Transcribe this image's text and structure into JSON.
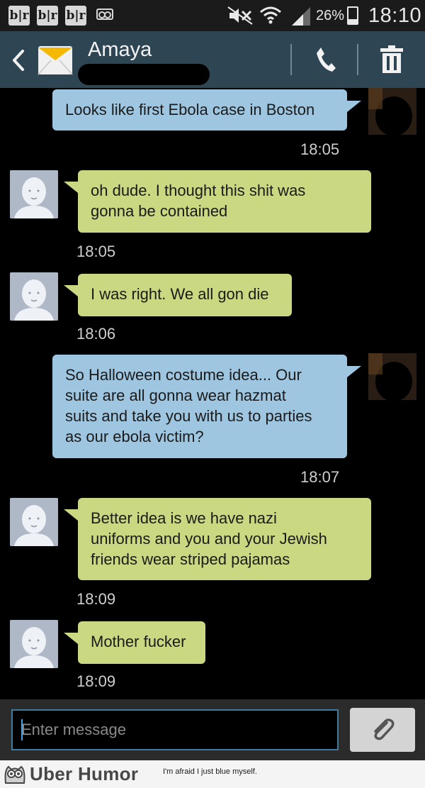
{
  "status_bar": {
    "notification_icons": [
      "b|r",
      "b|r",
      "b|r"
    ],
    "battery_percent": "26%",
    "battery_level": 0.26,
    "time": "18:10",
    "icons": [
      "voicemail-icon",
      "mute-icon",
      "wifi-icon",
      "signal-icon",
      "battery-icon"
    ]
  },
  "header": {
    "contact_name": "Amaya",
    "icons": [
      "back-icon",
      "envelope-icon",
      "phone-icon",
      "trash-icon"
    ]
  },
  "messages": [
    {
      "direction": "outgoing",
      "text_lines": [
        "Looks like first Ebola case in Boston"
      ],
      "time": "18:05"
    },
    {
      "direction": "incoming",
      "text_lines": [
        "oh dude. I thought this shit was",
        "gonna be contained"
      ],
      "time": "18:05"
    },
    {
      "direction": "incoming",
      "text_lines": [
        "I was right. We all gon die"
      ],
      "time": "18:06"
    },
    {
      "direction": "outgoing",
      "text_lines": [
        "So Halloween costume idea...  Our",
        "suite are all gonna wear hazmat",
        "suits and take you with us to parties",
        "as our ebola victim?"
      ],
      "time": "18:07"
    },
    {
      "direction": "incoming",
      "text_lines": [
        "Better idea is we have nazi",
        "uniforms and you and your Jewish",
        "friends wear striped pajamas"
      ],
      "time": "18:09"
    },
    {
      "direction": "incoming",
      "text_lines": [
        "Mother fucker"
      ],
      "time": "18:09"
    }
  ],
  "composer": {
    "placeholder": "Enter message",
    "attach_icon": "paperclip-icon"
  },
  "watermark": {
    "brand": "Uber Humor",
    "tagline": "I'm afraid I just blue myself."
  },
  "colors": {
    "header_bg": "#2e4653",
    "outgoing_bubble": "#9fc6e0",
    "incoming_bubble": "#cbd882",
    "input_border": "#3f7ba1"
  }
}
